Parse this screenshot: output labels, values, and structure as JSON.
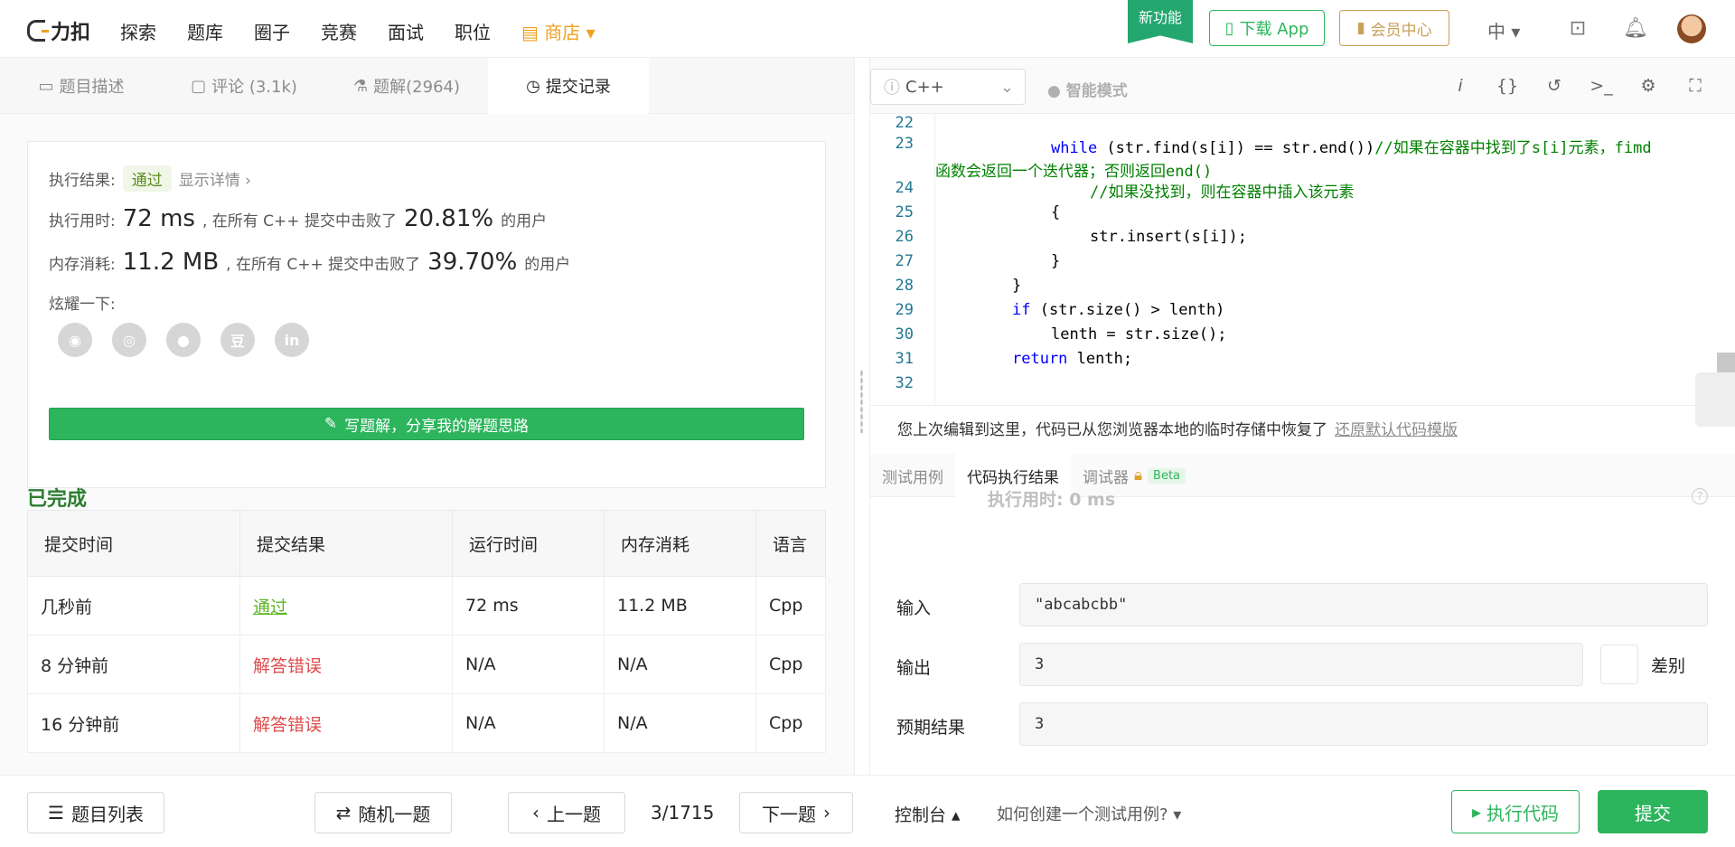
{
  "header": {
    "logo": "力扣",
    "nav": [
      "探索",
      "题库",
      "圈子",
      "竞赛",
      "面试",
      "职位"
    ],
    "shop": "商店",
    "new_feature": "新功能",
    "download_app": "下载 App",
    "vip": "会员中心",
    "lang": "中"
  },
  "left_tabs": [
    {
      "label": "题目描述",
      "icon": "description-icon"
    },
    {
      "label": "评论 (3.1k)",
      "icon": "comment-icon"
    },
    {
      "label": "题解(2964)",
      "icon": "flask-icon"
    },
    {
      "label": "提交记录",
      "icon": "clock-icon"
    }
  ],
  "result": {
    "status_label": "执行结果:",
    "status": "通过",
    "details": "显示详情",
    "time_label": "执行用时:",
    "time_value": "72 ms",
    "time_text": ", 在所有 C++ 提交中击败了",
    "time_pct": "20.81%",
    "users": "的用户",
    "mem_label": "内存消耗:",
    "mem_value": "11.2 MB",
    "mem_text": ", 在所有 C++ 提交中击败了",
    "mem_pct": "39.70%",
    "share_label": "炫耀一下:",
    "share_icons": [
      "wechat-icon",
      "weibo-icon",
      "qq-icon",
      "douban-icon",
      "linkedin-icon"
    ],
    "write_button": "写题解，分享我的解题思路"
  },
  "submissions": {
    "headers": [
      "提交时间",
      "提交结果",
      "运行时间",
      "内存消耗",
      "语言"
    ],
    "rows": [
      [
        "几秒前",
        "通过",
        "72 ms",
        "11.2 MB",
        "Cpp"
      ],
      [
        "8 分钟前",
        "解答错误",
        "N/A",
        "N/A",
        "Cpp"
      ],
      [
        "16 分钟前",
        "解答错误",
        "N/A",
        "N/A",
        "Cpp"
      ]
    ]
  },
  "editor": {
    "language": "C++",
    "mode": "智能模式",
    "line_numbers": [
      "22",
      "23",
      "",
      "24",
      "25",
      "26",
      "27",
      "28",
      "29",
      "30",
      "31",
      "32"
    ],
    "restore_text": "您上次编辑到这里，代码已从您浏览器本地的临时存储中恢复了",
    "restore_link": "还原默认代码模版"
  },
  "result_tabs": [
    "测试用例",
    "代码执行结果",
    "调试器",
    "Beta"
  ],
  "run_result": {
    "status": "已完成",
    "exec_time": "执行用时: 0 ms",
    "input_label": "输入",
    "input_value": "\"abcabcbb\"",
    "output_label": "输出",
    "output_value": "3",
    "expected_label": "预期结果",
    "expected_value": "3",
    "diff_label": "差别"
  },
  "footer": {
    "problem_list": "题目列表",
    "random": "随机一题",
    "prev": "上一题",
    "page": "3/1715",
    "next": "下一题",
    "console": "控制台",
    "howto": "如何创建一个测试用例?",
    "run": "执行代码",
    "submit": "提交"
  },
  "colors": {
    "brand_green": "#2db55d",
    "pass": "#5cb524",
    "error": "#e04c4c",
    "shop": "#f0a020",
    "vip": "#c7a05a"
  }
}
